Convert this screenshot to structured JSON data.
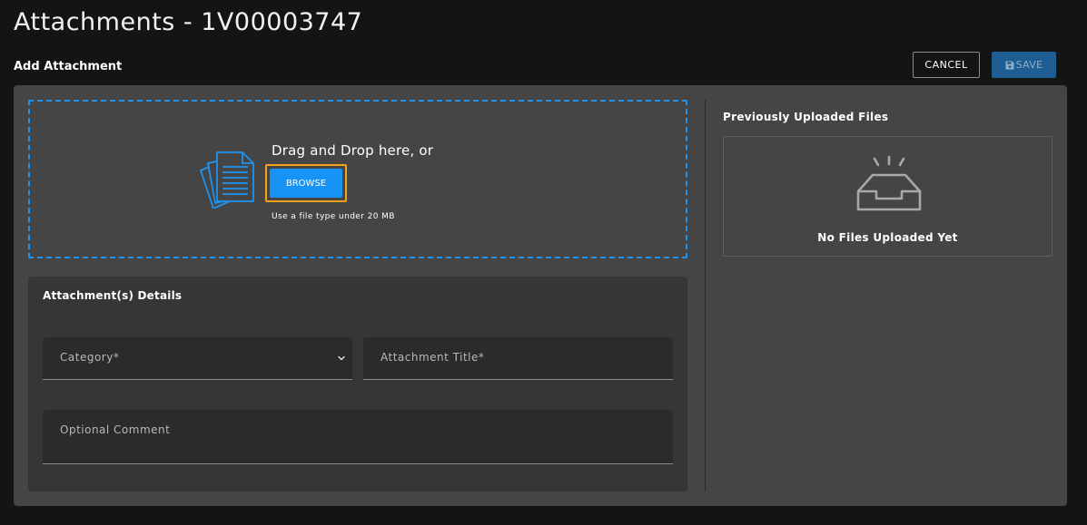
{
  "page": {
    "title": "Attachments - 1V00003747",
    "section_title": "Add Attachment"
  },
  "actions": {
    "cancel_label": "CANCEL",
    "save_label": "SAVE"
  },
  "dropzone": {
    "drag_text": "Drag and Drop here, or",
    "browse_label": "BROWSE",
    "hint": "Use a file type under 20 MB",
    "icon": "documents-icon"
  },
  "details": {
    "title": "Attachment(s) Details",
    "category": {
      "label": "Category*",
      "value": ""
    },
    "attachment_title": {
      "label": "Attachment Title*",
      "value": ""
    },
    "comment": {
      "label": "Optional Comment",
      "value": ""
    }
  },
  "previous": {
    "title": "Previously Uploaded Files",
    "empty_text": "No Files Uploaded Yet",
    "icon": "empty-tray-icon"
  },
  "colors": {
    "accent": "#1793f5",
    "focus_ring": "#f0a21a",
    "save_disabled": "#1f5e92",
    "panel": "#454545",
    "background": "#141414"
  }
}
